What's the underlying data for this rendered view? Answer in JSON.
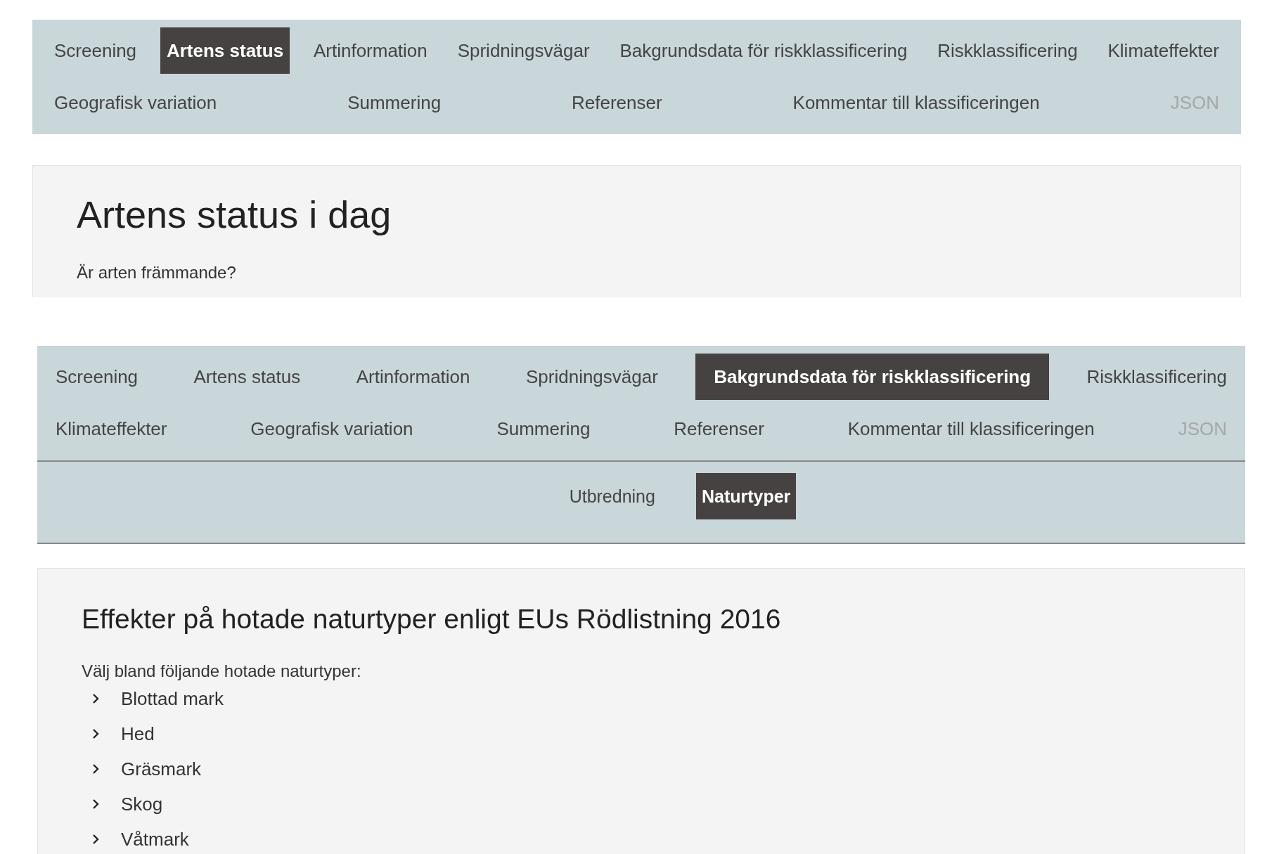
{
  "nav_top": {
    "tabs": [
      {
        "label": "Screening",
        "selected": false,
        "disabled": false
      },
      {
        "label": "Artens status",
        "selected": true,
        "disabled": false
      },
      {
        "label": "Artinformation",
        "selected": false,
        "disabled": false
      },
      {
        "label": "Spridningsvägar",
        "selected": false,
        "disabled": false
      },
      {
        "label": "Bakgrundsdata för riskklassificering",
        "selected": false,
        "disabled": false
      },
      {
        "label": "Riskklassificering",
        "selected": false,
        "disabled": false
      },
      {
        "label": "Klimateffekter",
        "selected": false,
        "disabled": false
      },
      {
        "label": "Geografisk variation",
        "selected": false,
        "disabled": false
      },
      {
        "label": "Summering",
        "selected": false,
        "disabled": false
      },
      {
        "label": "Referenser",
        "selected": false,
        "disabled": false
      },
      {
        "label": "Kommentar till klassificeringen",
        "selected": false,
        "disabled": false
      },
      {
        "label": "JSON",
        "selected": false,
        "disabled": true
      }
    ]
  },
  "status_panel": {
    "title": "Artens status i dag",
    "question": "Är arten främmande?"
  },
  "nav_second": {
    "tabs": [
      {
        "label": "Screening",
        "selected": false,
        "disabled": false
      },
      {
        "label": "Artens status",
        "selected": false,
        "disabled": false
      },
      {
        "label": "Artinformation",
        "selected": false,
        "disabled": false
      },
      {
        "label": "Spridningsvägar",
        "selected": false,
        "disabled": false
      },
      {
        "label": "Bakgrundsdata för riskklassificering",
        "selected": true,
        "disabled": false
      },
      {
        "label": "Riskklassificering",
        "selected": false,
        "disabled": false
      },
      {
        "label": "Klimateffekter",
        "selected": false,
        "disabled": false
      },
      {
        "label": "Geografisk variation",
        "selected": false,
        "disabled": false
      },
      {
        "label": "Summering",
        "selected": false,
        "disabled": false
      },
      {
        "label": "Referenser",
        "selected": false,
        "disabled": false
      },
      {
        "label": "Kommentar till klassificeringen",
        "selected": false,
        "disabled": false
      },
      {
        "label": "JSON",
        "selected": false,
        "disabled": true
      }
    ]
  },
  "subnav": [
    {
      "label": "Utbredning",
      "selected": false
    },
    {
      "label": "Naturtyper",
      "selected": true
    }
  ],
  "habitat_panel": {
    "title": "Effekter på hotade naturtyper enligt EUs Rödlistning 2016",
    "prompt": "Välj bland följande hotade naturtyper:",
    "items": [
      {
        "label": "Blottad mark",
        "expanded": false
      },
      {
        "label": "Hed",
        "expanded": false
      },
      {
        "label": "Gräsmark",
        "expanded": false
      },
      {
        "label": "Skog",
        "expanded": false
      },
      {
        "label": "Våtmark",
        "expanded": false
      }
    ]
  }
}
